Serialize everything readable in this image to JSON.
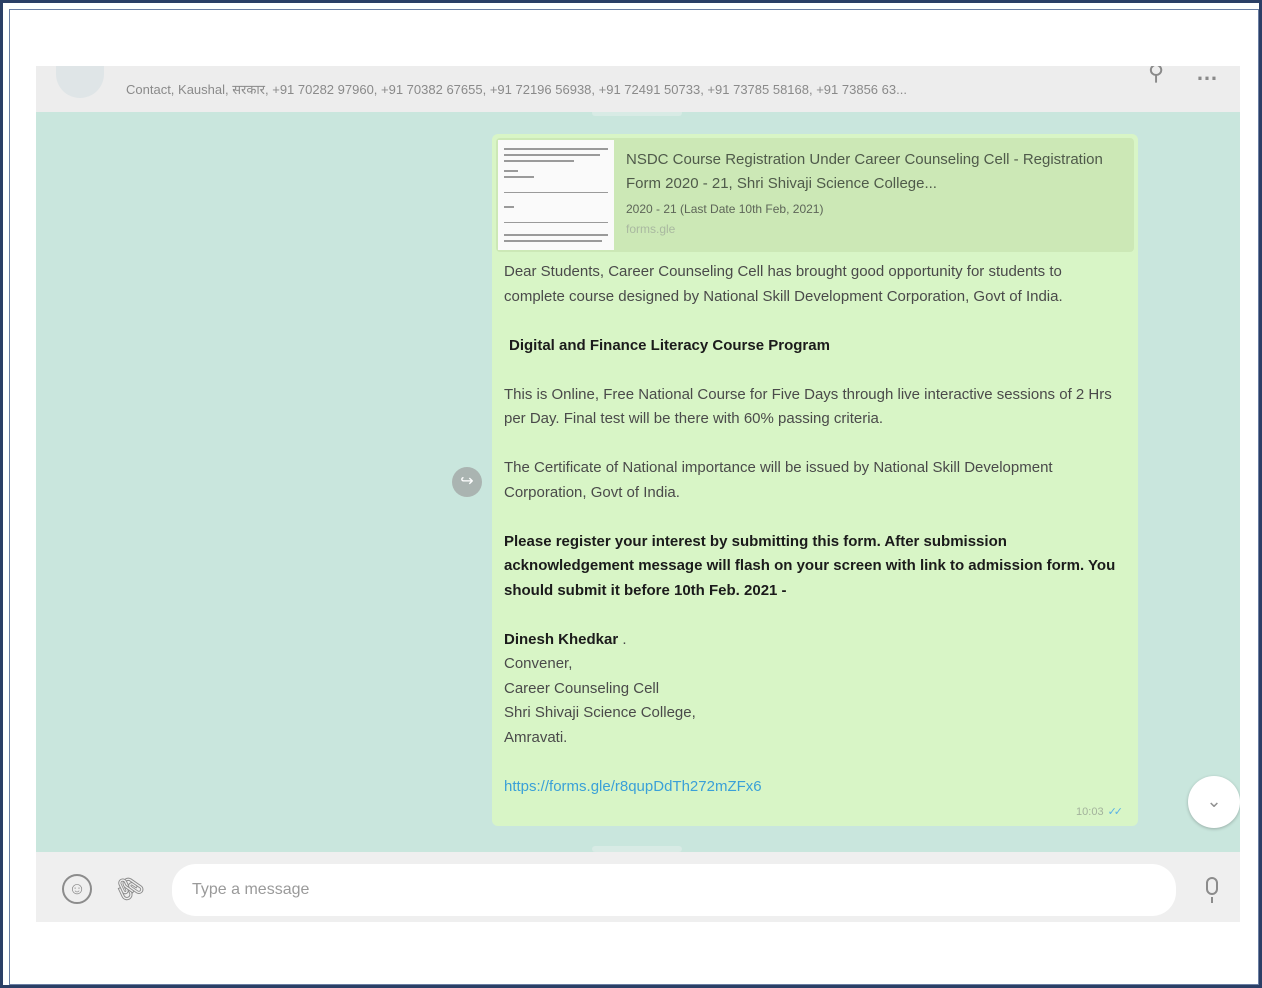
{
  "header": {
    "participants": "Contact, Kaushal, सरकार, +91 70282 97960, +91 70382 67655, +91 72196 56938, +91 72491 50733, +91 73785 58168, +91 73856 63..."
  },
  "message": {
    "preview": {
      "title": "NSDC Course Registration Under Career Counseling Cell - Registration Form 2020 - 21, Shri Shivaji Science College...",
      "subtitle": "2020 - 21 (Last Date 10th Feb, 2021)",
      "domain": "forms.gle"
    },
    "intro": "Dear Students, Career Counseling Cell has brought good opportunity for students to complete course designed by National Skill Development Corporation, Govt of India.",
    "heading": "Digital and Finance Literacy Course Program",
    "details": "This is Online, Free National Course for Five Days through live interactive sessions of 2 Hrs per Day. Final test will be there with 60% passing criteria.",
    "certificate": "The Certificate of National importance will be issued by National Skill Development Corporation, Govt of India.",
    "instruction": "Please register your interest by submitting this form. After submission acknowledgement message will flash on your screen with link to admission form. You should submit it before 10th Feb. 2021 -",
    "signature": {
      "name": "Dinesh Khedkar",
      "suffix": ".",
      "lines": [
        "Convener,",
        "Career Counseling Cell",
        "Shri Shivaji Science College,",
        "Amravati."
      ]
    },
    "link": "https://forms.gle/r8qupDdTh272mZFx6",
    "time": "10:03",
    "ticks": "✓✓"
  },
  "compose": {
    "placeholder": "Type a message"
  },
  "icons": {
    "search": "⚲",
    "menu": "…",
    "forward": "↪",
    "scroll_down": "⌄",
    "emoji": "☺",
    "attach": "🖇"
  },
  "colors": {
    "chat_bg": "#c9e6dd",
    "bubble_bg": "#d8f5c6",
    "link": "#3aa0d8",
    "frame": "#2b3f66"
  }
}
